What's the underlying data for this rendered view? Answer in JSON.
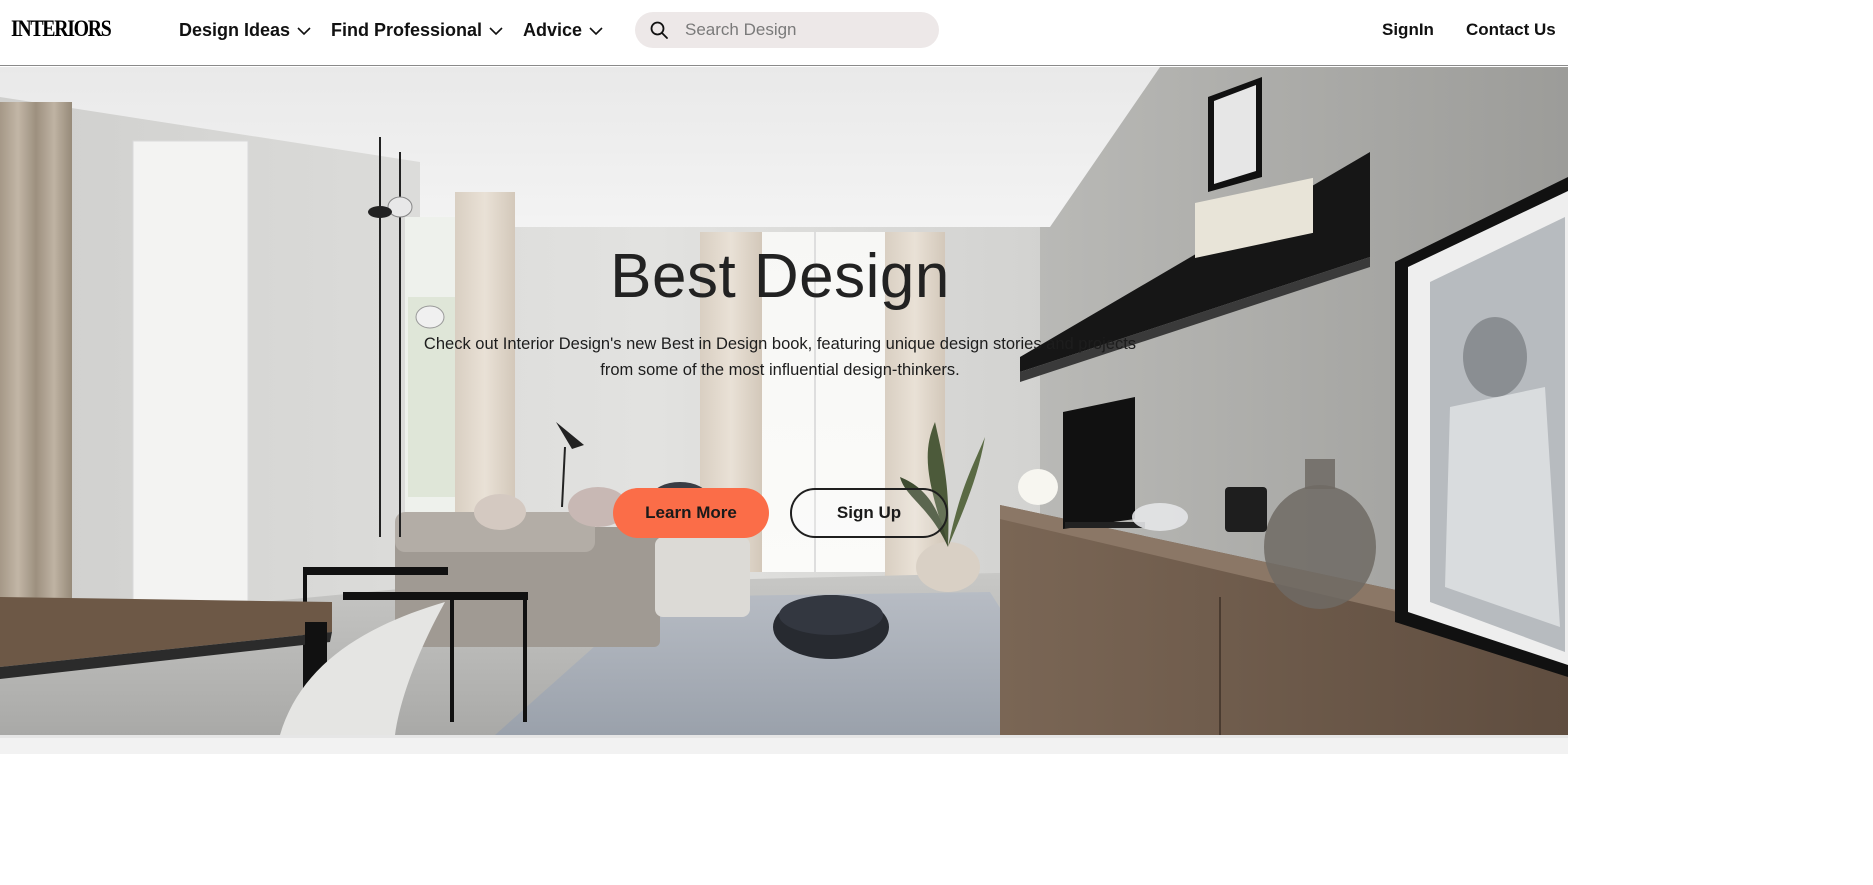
{
  "header": {
    "logo": "INTERIORS",
    "nav": [
      {
        "label": "Design Ideas"
      },
      {
        "label": "Find Professional"
      },
      {
        "label": "Advice"
      }
    ],
    "search": {
      "placeholder": "Search Design"
    },
    "signin_label": "SignIn",
    "contact_label": "Contact Us"
  },
  "hero": {
    "title": "Best Design",
    "subtitle": "Check out Interior Design's new Best in Design book, featuring unique design stories and projects from some of the most influential design-thinkers.",
    "learn_more_label": "Learn More",
    "signup_label": "Sign Up"
  },
  "colors": {
    "accent": "#fb6d48",
    "search_bg": "#ede8e8",
    "text": "#111111"
  },
  "icons": [
    "search-icon",
    "chevron-down-icon"
  ]
}
